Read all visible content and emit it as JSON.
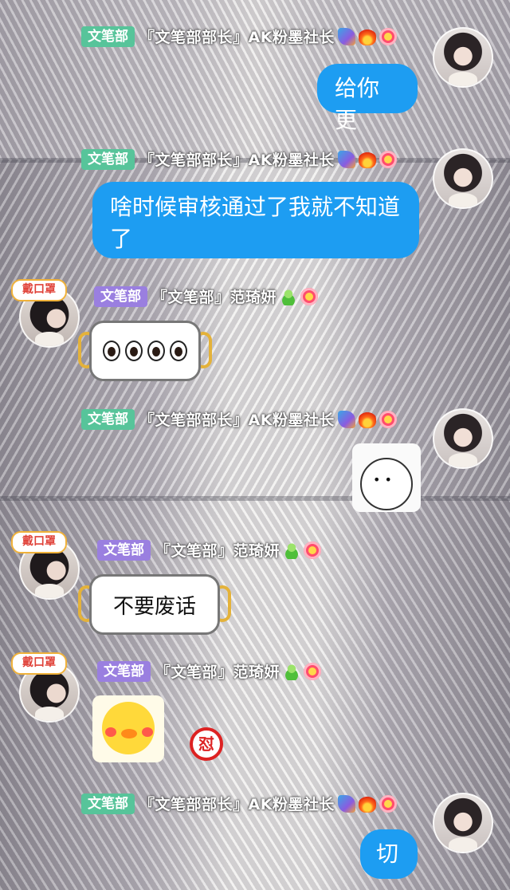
{
  "colors": {
    "bubble_blue": "#1d9df2",
    "dept_green": "#57c49a",
    "dept_purple": "#9a7fe0"
  },
  "messages": [
    {
      "sender": {
        "dept": "文笔部",
        "title": "『文笔部部长』AK粉墨社长"
      },
      "side": "right",
      "text": "给你更"
    },
    {
      "sender": {
        "dept": "文笔部",
        "title": "『文笔部部长』AK粉墨社长"
      },
      "side": "right",
      "text": "啥时候审核通过了我就不知道了"
    },
    {
      "sender": {
        "dept": "文笔部",
        "title": "『文笔部』范琦妍",
        "avatar_badge": "戴口罩"
      },
      "side": "left",
      "sticker": "four-eyes-mask",
      "eyes_count": 4
    },
    {
      "sender": {
        "dept": "文笔部",
        "title": "『文笔部部长』AK粉墨社长"
      },
      "side": "right",
      "sticker": "crying-face-sticker"
    },
    {
      "sender": {
        "dept": "文笔部",
        "title": "『文笔部』范琦妍",
        "avatar_badge": "戴口罩"
      },
      "side": "left",
      "text": "不要废话"
    },
    {
      "sender": {
        "dept": "文笔部",
        "title": "『文笔部』范琦妍",
        "avatar_badge": "戴口罩"
      },
      "side": "left",
      "sticker": "yellow-duck-sticker",
      "extra_icon": {
        "name": "angry-character-icon",
        "glyph": "怼"
      }
    },
    {
      "sender": {
        "dept": "文笔部",
        "title": "『文笔部部长』AK粉墨社长"
      },
      "side": "right",
      "text": "切"
    }
  ]
}
